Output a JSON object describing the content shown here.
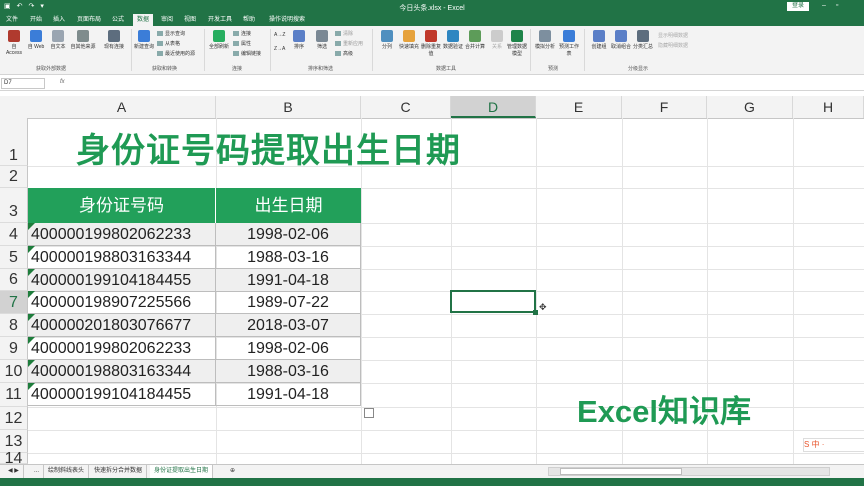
{
  "window": {
    "title": "今日头条.xlsx - Excel",
    "login_label": "登录"
  },
  "ribbon_tabs": [
    "文件",
    "开始",
    "插入",
    "页面布局",
    "公式",
    "数据",
    "审阅",
    "视图",
    "开发工具",
    "帮助",
    "操作说明搜索"
  ],
  "active_tab_index": 5,
  "ribbon": {
    "get_external": {
      "access": "自 Access",
      "web": "自 Web",
      "text": "自文本",
      "other": "自其他来源",
      "existing": "现有连接",
      "group": "获取外部数据"
    },
    "get_transform": {
      "new_query": "新建查询",
      "show_queries": "显示查询",
      "from_table": "从表格",
      "recent": "最近使用的源",
      "group": "获取和转换"
    },
    "connections": {
      "refresh_all": "全部刷新",
      "connections": "连接",
      "properties": "属性",
      "edit_links": "编辑链接",
      "group": "连接"
    },
    "sort_filter": {
      "sort_az": "A→Z",
      "sort_za": "Z→A",
      "sort": "排序",
      "filter": "筛选",
      "clear": "清除",
      "reapply": "重新应用",
      "advanced": "高级",
      "group": "排序和筛选"
    },
    "data_tools": {
      "text_to_col": "分列",
      "flash_fill": "快速填充",
      "remove_dup": "删除重复值",
      "validation": "数据验证",
      "consolidate": "合并计算",
      "relations": "关系",
      "manage_model": "管理数据模型",
      "group": "数据工具"
    },
    "forecast": {
      "what_if": "模拟分析",
      "forecast_sheet": "预测工作表",
      "group": "预测"
    },
    "outline": {
      "group_btn": "创建组",
      "ungroup": "取消组合",
      "subtotal": "分类汇总",
      "show_detail": "显示明细数据",
      "hide_detail": "隐藏明细数据",
      "group": "分级显示"
    }
  },
  "formula_bar": {
    "name_box": "D7",
    "fx": "fx",
    "value": ""
  },
  "columns": [
    "A",
    "B",
    "C",
    "D",
    "E",
    "F",
    "G",
    "H"
  ],
  "selected_column": "D",
  "rows": [
    "1",
    "2",
    "3",
    "4",
    "5",
    "6",
    "7",
    "8",
    "9",
    "10",
    "11",
    "12",
    "13",
    "14"
  ],
  "selected_row": "7",
  "sheet_title": "身份证号码提取出生日期",
  "table": {
    "headers": [
      "身份证号码",
      "出生日期"
    ],
    "rows": [
      {
        "id": "400000199802062233",
        "date": "1998-02-06"
      },
      {
        "id": "400000198803163344",
        "date": "1988-03-16"
      },
      {
        "id": "400000199104184455",
        "date": "1991-04-18"
      },
      {
        "id": "400000198907225566",
        "date": "1989-07-22"
      },
      {
        "id": "400000201803076677",
        "date": "2018-03-07"
      },
      {
        "id": "400000199802062233",
        "date": "1998-02-06"
      },
      {
        "id": "400000198803163344",
        "date": "1988-03-16"
      },
      {
        "id": "400000199104184455",
        "date": "1991-04-18"
      }
    ]
  },
  "watermark": "Excel知识库",
  "sheet_tabs": [
    "...",
    "绘制斜线表头",
    "快速拆分合并数据",
    "身份证提取出生日期"
  ],
  "active_sheet_index": 3,
  "add_sheet": "⊕",
  "colors": {
    "excel_green": "#217346",
    "title_green": "#1f9a54",
    "header_green": "#22a05a"
  }
}
